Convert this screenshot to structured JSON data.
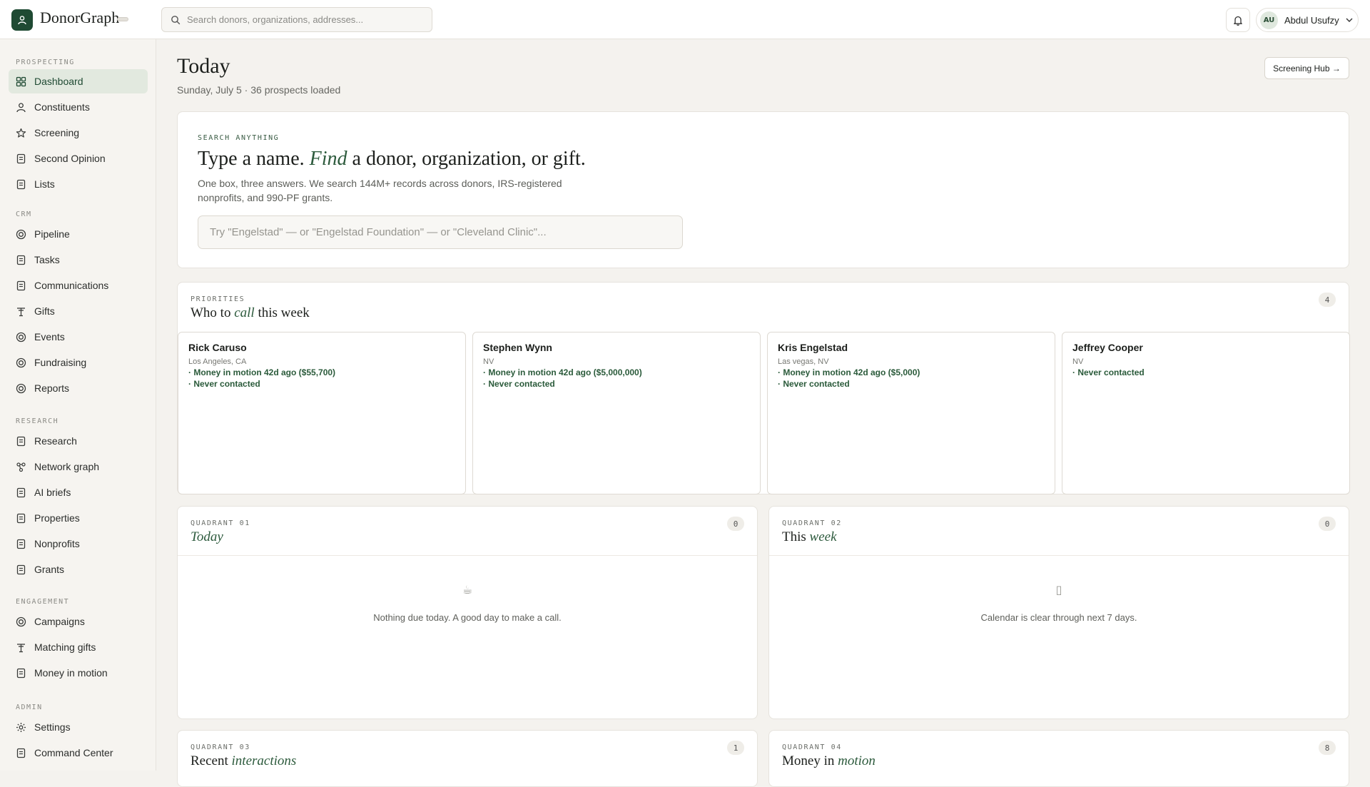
{
  "app": {
    "name": "DonorGraph"
  },
  "topbar": {
    "search_placeholder": "Search donors, organizations, addresses...",
    "user": {
      "initials": "AU",
      "name": "Abdul Usufzy"
    }
  },
  "sidebar": {
    "sections": [
      {
        "label": "PROSPECTING",
        "items": [
          {
            "label": "Dashboard",
            "icon": "grid-icon",
            "active": true
          },
          {
            "label": "Constituents",
            "icon": "user-icon"
          },
          {
            "label": "Screening",
            "icon": "star-icon"
          },
          {
            "label": "Second Opinion",
            "icon": "doc-icon"
          },
          {
            "label": "Lists",
            "icon": "doc-icon"
          }
        ]
      },
      {
        "label": "CRM",
        "items": [
          {
            "label": "Pipeline",
            "icon": "target-icon"
          },
          {
            "label": "Tasks",
            "icon": "doc-icon"
          },
          {
            "label": "Communications",
            "icon": "doc-icon"
          },
          {
            "label": "Gifts",
            "icon": "gift-icon"
          },
          {
            "label": "Events",
            "icon": "target-icon"
          },
          {
            "label": "Fundraising",
            "icon": "target-icon"
          },
          {
            "label": "Reports",
            "icon": "target-icon"
          }
        ]
      },
      {
        "label": "RESEARCH",
        "items": [
          {
            "label": "Research",
            "icon": "doc-icon"
          },
          {
            "label": "Network graph",
            "icon": "network-icon"
          },
          {
            "label": "AI briefs",
            "icon": "doc-icon"
          },
          {
            "label": "Properties",
            "icon": "doc-icon"
          },
          {
            "label": "Nonprofits",
            "icon": "doc-icon"
          },
          {
            "label": "Grants",
            "icon": "doc-icon"
          }
        ]
      },
      {
        "label": "ENGAGEMENT",
        "items": [
          {
            "label": "Campaigns",
            "icon": "target-icon"
          },
          {
            "label": "Matching gifts",
            "icon": "gift-icon"
          },
          {
            "label": "Money in motion",
            "icon": "doc-icon"
          }
        ]
      },
      {
        "label": "ADMIN",
        "items": [
          {
            "label": "Settings",
            "icon": "gear-icon"
          },
          {
            "label": "Command Center",
            "icon": "doc-icon"
          }
        ]
      }
    ]
  },
  "header": {
    "title": "Today",
    "subtitle": "Sunday, July 5 · 36 prospects loaded",
    "hub_button": "Screening Hub →"
  },
  "search_card": {
    "eyebrow": "SEARCH ANYTHING",
    "title_pre": "Type a name.",
    "title_em": "Find",
    "title_post": "a donor, organization, or gift.",
    "description": "One box, three answers. We search 144M+ records across donors, IRS-registered nonprofits, and 990-PF grants.",
    "input_placeholder": "Try \"Engelstad\" — or \"Engelstad Foundation\" — or \"Cleveland Clinic\"..."
  },
  "priorities": {
    "eyebrow": "PRIORITIES",
    "title_pre": "Who to",
    "title_em": "call",
    "title_post": "this week",
    "count": "4",
    "people": [
      {
        "name": "Rick Caruso",
        "location": "Los Angeles, CA",
        "signals": [
          "· Money in motion 42d ago ($55,700)",
          "· Never contacted"
        ]
      },
      {
        "name": "Stephen Wynn",
        "location": "NV",
        "signals": [
          "· Money in motion 42d ago ($5,000,000)",
          "· Never contacted"
        ]
      },
      {
        "name": "Kris Engelstad",
        "location": "Las vegas, NV",
        "signals": [
          "· Money in motion 42d ago ($5,000)",
          "· Never contacted"
        ]
      },
      {
        "name": "Jeffrey Cooper",
        "location": "NV",
        "signals": [
          "· Never contacted"
        ]
      }
    ]
  },
  "quadrants": [
    {
      "eyebrow": "QUADRANT 01",
      "title_pre": "",
      "title_em": "Today",
      "count": "0",
      "empty_icon": "coffee-icon",
      "empty_glyph": "☕",
      "empty_text": "Nothing due today. A good day to make a call."
    },
    {
      "eyebrow": "QUADRANT 02",
      "title_pre": "This",
      "title_em": "week",
      "count": "0",
      "empty_icon": "calendar-icon",
      "empty_glyph": "▯",
      "empty_text": "Calendar is clear through next 7 days."
    },
    {
      "eyebrow": "QUADRANT 03",
      "title_pre": "Recent",
      "title_em": "interactions",
      "count": "1"
    },
    {
      "eyebrow": "QUADRANT 04",
      "title_pre": "Money in",
      "title_em": "motion",
      "count": "8"
    }
  ]
}
